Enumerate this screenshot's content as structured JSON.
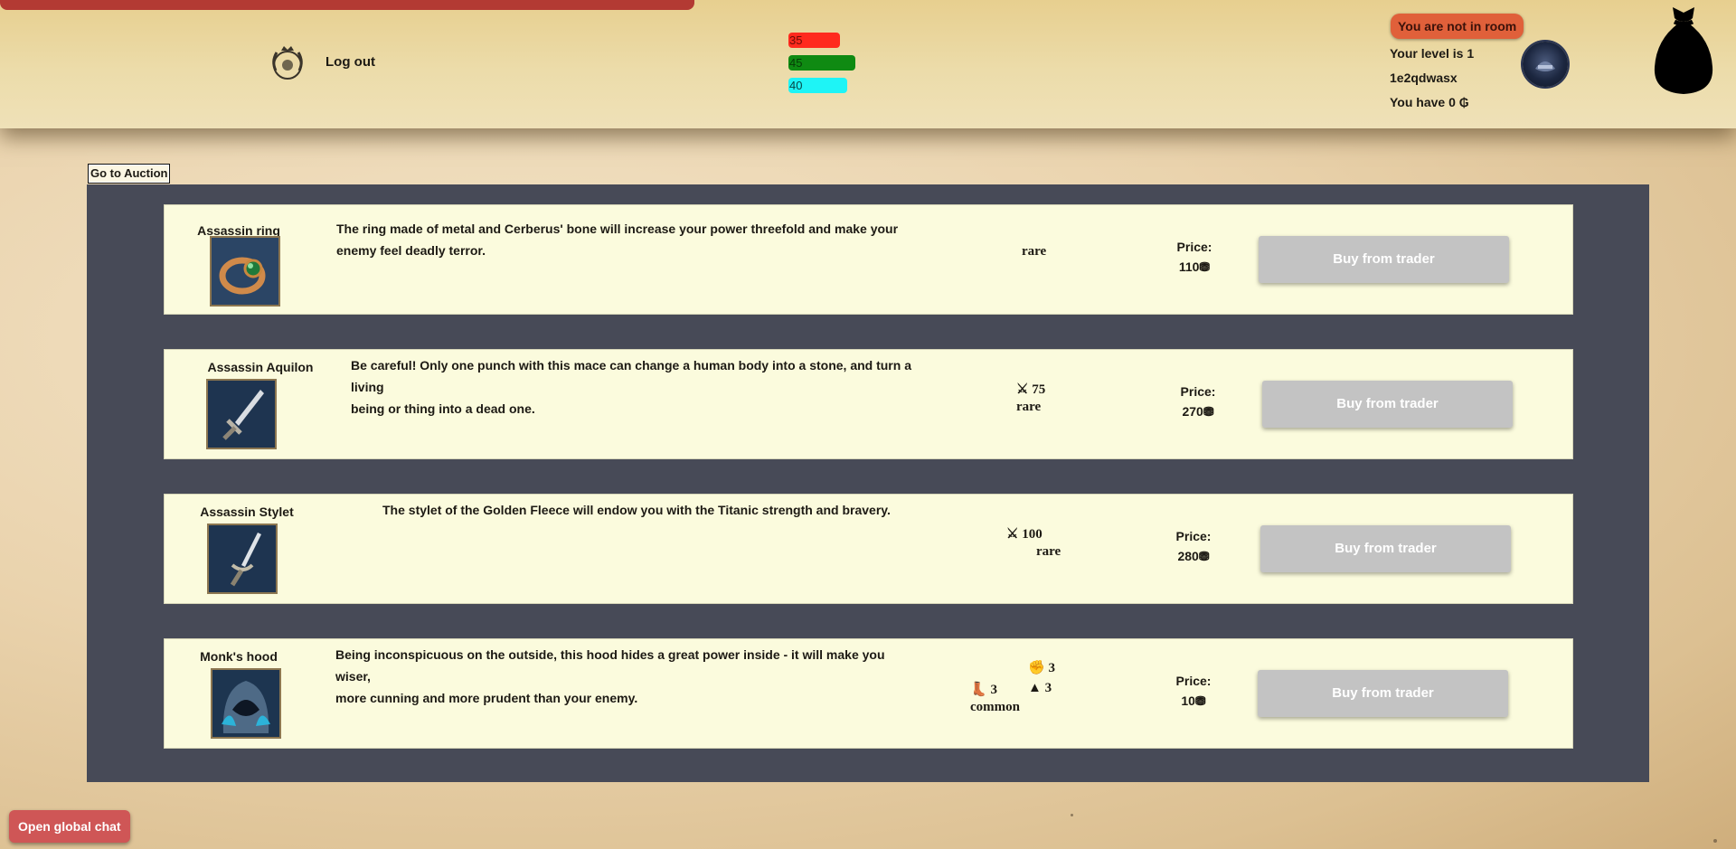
{
  "header": {
    "logout_label": "Log out",
    "health": "35",
    "stamina": "45",
    "mana": "40",
    "room_status": "You are not in room",
    "level_text": "Your level is 1",
    "username": "1e2qdwasx",
    "gold_text": "You have 0 ₲"
  },
  "main": {
    "auction_label": "Go to Auction",
    "price_label": "Price:",
    "buy_label": "Buy from trader",
    "items": [
      {
        "name": "Assassin ring",
        "description_lines": [
          "The ring made of metal and Cerberus' bone will increase your power threefold and make your",
          "enemy feel deadly terror."
        ],
        "rarity": "rare",
        "price": "110",
        "icon": "ring-icon"
      },
      {
        "name": "Assassin Aquilon",
        "description_lines": [
          "Be careful! Only one punch with this mace can change a human body into a stone, and turn a living",
          "being or thing into a dead one."
        ],
        "stat_value": "75",
        "rarity": "rare",
        "price": "270",
        "icon": "sword-icon"
      },
      {
        "name": "Assassin Stylet",
        "description_lines": [
          "The stylet of the Golden Fleece will endow you with the Titanic strength and bravery."
        ],
        "stat_value": "100",
        "rarity": "rare",
        "price": "280",
        "icon": "dagger-icon"
      },
      {
        "name": "Monk's hood",
        "description_lines": [
          "Being inconspicuous on the outside, this hood hides a great power inside - it will make you wiser,",
          "more cunning and more prudent than your enemy."
        ],
        "strength": "3",
        "agility": "3",
        "intelligence": "3",
        "rarity": "common",
        "price": "10",
        "icon": "hood-icon"
      }
    ]
  },
  "chat": {
    "open_label": "Open global chat"
  },
  "colors": {
    "health_bar": "#ff2a1e",
    "stamina_bar": "#0f8a12",
    "mana_bar": "#1ef4f6",
    "panel": "#474a57",
    "card": "#fbfbdd",
    "buy_button": "#c3c3c3",
    "room_badge": "#e0603a",
    "chat_button": "#cf5656"
  }
}
